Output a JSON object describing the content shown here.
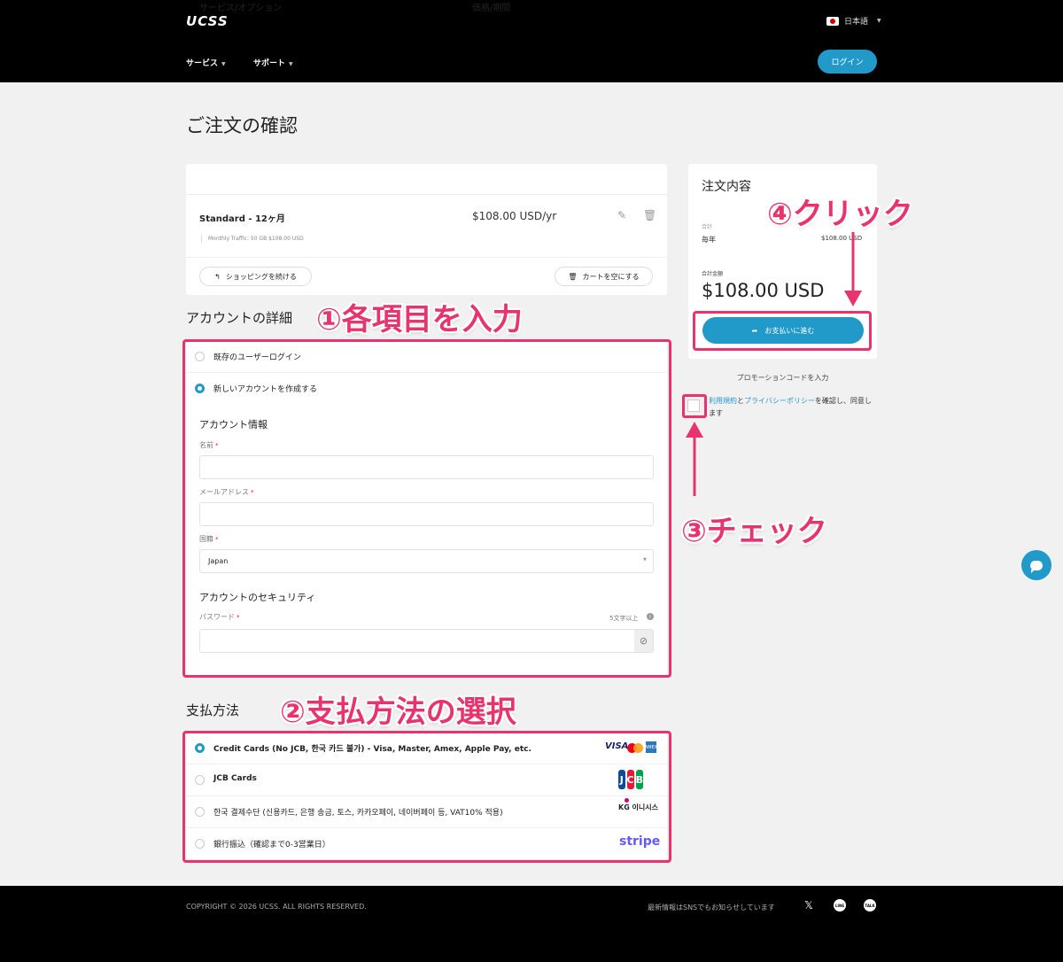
{
  "header": {
    "logo": "UCSS",
    "language": "日本語",
    "nav": [
      {
        "label": "サービス"
      },
      {
        "label": "サポート"
      }
    ],
    "login_label": "ログイン"
  },
  "page_title": "ご注文の確認",
  "cart": {
    "col_service": "サービス/オプション",
    "col_price": "価格/期間",
    "product_name": "Standard - 12ヶ月",
    "product_detail": "Monthly Traffic: 50 GB $108.00 USD",
    "product_price": "$108.00 USD/yr",
    "continue_shopping": "ショッピングを続ける",
    "empty_cart": "カートを空にする"
  },
  "account": {
    "section_title": "アカウントの詳細",
    "existing_login": "既存のユーザーログイン",
    "new_account": "新しいアカウントを作成する",
    "info_heading": "アカウント情報",
    "name_label": "名前",
    "email_label": "メールアドレス",
    "country_label": "国籍",
    "country_value": "Japan",
    "security_heading": "アカウントのセキュリティ",
    "password_label": "パスワード",
    "password_hint": "5文字以上",
    "required_mark": "*"
  },
  "payment": {
    "section_title": "支払方法",
    "methods": [
      {
        "label": "Credit Cards (No JCB, 한국 카드 불가) - Visa, Master, Amex, Apple Pay, etc.",
        "selected": true
      },
      {
        "label": "JCB Cards",
        "selected": false
      },
      {
        "label": "한국 결제수단 (신용카드, 은행 송금, 토스, 카카오페이, 네이버페이 등, VAT10% 적용)",
        "selected": false
      },
      {
        "label": "銀行振込（確認まで0-3営業日）",
        "selected": false
      }
    ],
    "logos": {
      "visa": "VISA",
      "amex": "AMEX",
      "jcb": [
        "J",
        "C",
        "B"
      ],
      "kg": "KG 이니시스",
      "stripe": "stripe"
    }
  },
  "summary": {
    "title": "注文内容",
    "subtotal_label": "合計",
    "cycle_label": "毎年",
    "cycle_value": "$108.00 USD",
    "total_label": "合計金額",
    "total_value": "$108.00 USD",
    "checkout_label": "お支払いに進む",
    "promo_label": "プロモーションコードを入力",
    "terms_link": "利用規約",
    "terms_and": "と",
    "privacy_link": "プライバシーポリシー",
    "terms_suffix": "を確認し、同意します"
  },
  "footer": {
    "copyright": "COPYRIGHT © 2026 UCSS. ALL RIGHTS RESERVED.",
    "sns_text": "最新情報はSNSでもお知らせしています",
    "sns": [
      {
        "icon": "x-icon",
        "glyph": "𝕏"
      },
      {
        "icon": "line-icon",
        "glyph": "LINE"
      },
      {
        "icon": "talk-icon",
        "glyph": "TALK"
      }
    ]
  },
  "annotations": {
    "step1": "①各項目を入力",
    "step2": "②支払方法の選択",
    "step3": "③チェック",
    "step4": "④クリック"
  },
  "colors": {
    "accent": "#2199c9",
    "annotation": "#e8336d",
    "header_bg": "#000000",
    "page_bg": "#f1f1f1"
  }
}
